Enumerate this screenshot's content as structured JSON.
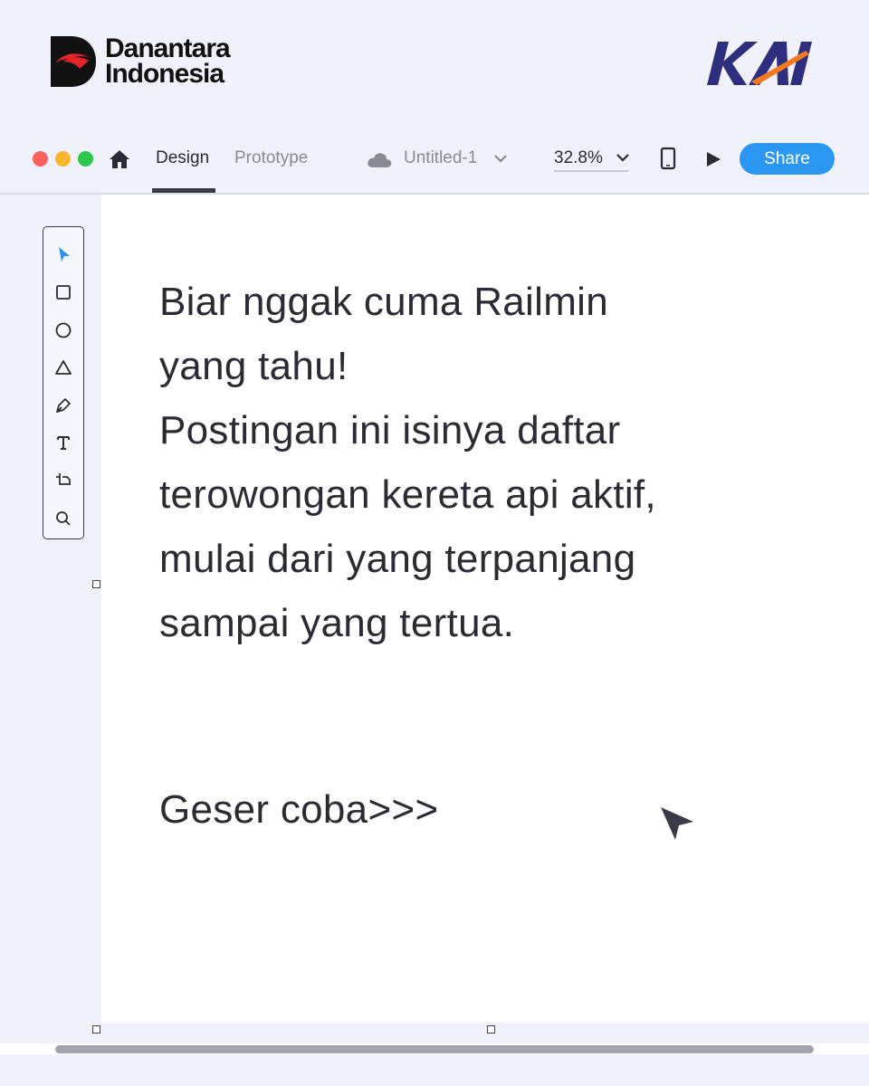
{
  "header": {
    "brand_line1": "Danantara",
    "brand_line2": "Indonesia",
    "partner_logo": "KAI",
    "brand_red": "#e3242b",
    "kai_navy": "#2d2f7e",
    "kai_orange": "#f47920"
  },
  "toolbar": {
    "window_controls": [
      "close",
      "minimize",
      "maximize"
    ],
    "home_icon": "home-icon",
    "tabs": [
      {
        "label": "Design",
        "active": true
      },
      {
        "label": "Prototype",
        "active": false
      }
    ],
    "file_name": "Untitled-1",
    "zoom": "32.8%",
    "share_label": "Share",
    "share_color": "#2c97f3"
  },
  "tools": [
    "select-arrow-icon",
    "rectangle-icon",
    "ellipse-icon",
    "triangle-icon",
    "pen-icon",
    "text-icon",
    "crop-frame-icon",
    "search-icon"
  ],
  "canvas": {
    "body_lines": [
      "Biar nggak cuma Railmin",
      "yang tahu!",
      "Postingan ini isinya daftar",
      "terowongan kereta api aktif,",
      "mulai dari yang terpanjang",
      "sampai yang tertua."
    ],
    "cta": "Geser coba>>>"
  }
}
